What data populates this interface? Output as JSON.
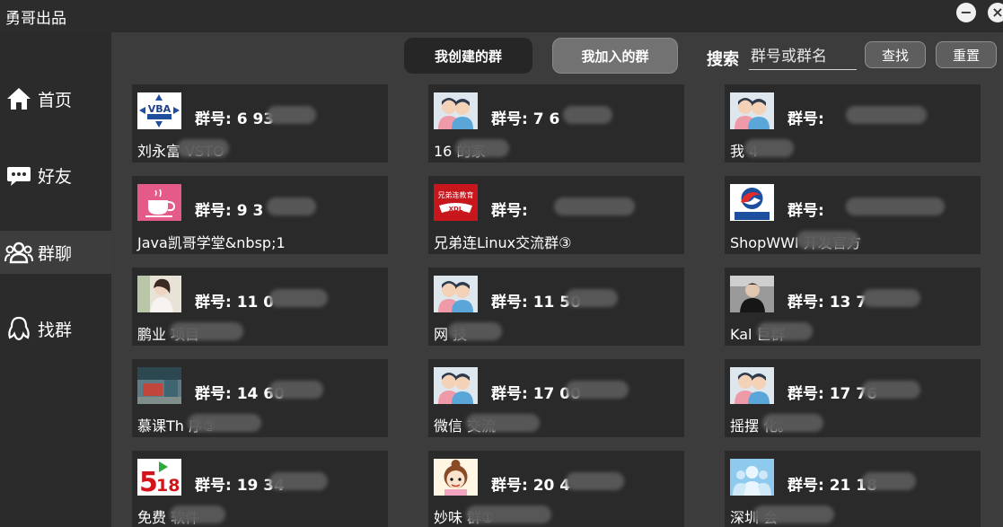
{
  "window": {
    "title": "勇哥出品",
    "minimize_glyph": "−",
    "close_glyph": "×"
  },
  "sidebar": {
    "items": [
      {
        "label": "首页",
        "icon": "home-icon"
      },
      {
        "label": "好友",
        "icon": "chat-bubble-icon"
      },
      {
        "label": "群聊",
        "icon": "group-icon",
        "active": true
      },
      {
        "label": "找群",
        "icon": "qq-penguin-icon"
      }
    ]
  },
  "toolbar": {
    "tab_created": "我创建的群",
    "tab_joined": "我加入的群",
    "search_label": "搜索",
    "search_placeholder": "群号或群名",
    "find_button": "查找",
    "reset_button": "重置"
  },
  "groups": [
    {
      "number": "群号: 6     93",
      "name": "刘永富      VSTO",
      "avatar": "vba-expert-icon"
    },
    {
      "number": "群号: 7     6",
      "name": "16      的家",
      "avatar": "couple-avatar-icon"
    },
    {
      "number": "群号:",
      "name": "我      4",
      "avatar": "couple-avatar-icon"
    },
    {
      "number": "群号: 9     3",
      "name": "Java凯哥学堂&nbsp;1",
      "avatar": "teacup-icon"
    },
    {
      "number": "群号:",
      "name": "兄弟连Linux交流群③",
      "avatar": "xdl-logo-icon"
    },
    {
      "number": "群号:",
      "name": "ShopWWI       开发官方",
      "avatar": "shopwwi-logo-icon"
    },
    {
      "number": "群号: 11      0",
      "name": "鹏业      项目",
      "avatar": "girl-photo-icon"
    },
    {
      "number": "群号: 11      50",
      "name": "网      技",
      "avatar": "couple-avatar-icon"
    },
    {
      "number": "群号: 13      7",
      "name": "Kal      巨群",
      "avatar": "person-photo-icon"
    },
    {
      "number": "群号: 14      60",
      "name": "慕课Th       序③",
      "avatar": "room-photo-icon"
    },
    {
      "number": "群号: 17      00",
      "name": "微信      交流",
      "avatar": "couple-avatar-icon"
    },
    {
      "number": "群号: 17      76",
      "name": "摇摆      化。",
      "avatar": "couple-avatar-icon"
    },
    {
      "number": "群号: 19      34",
      "name": "免费      软件",
      "avatar": "518-logo-icon"
    },
    {
      "number": "群号: 20      4",
      "name": "妙味      群①",
      "avatar": "cartoon-girl-icon"
    },
    {
      "number": "群号: 21      18",
      "name": "深圳      会",
      "avatar": "people-silhouette-icon"
    }
  ]
}
